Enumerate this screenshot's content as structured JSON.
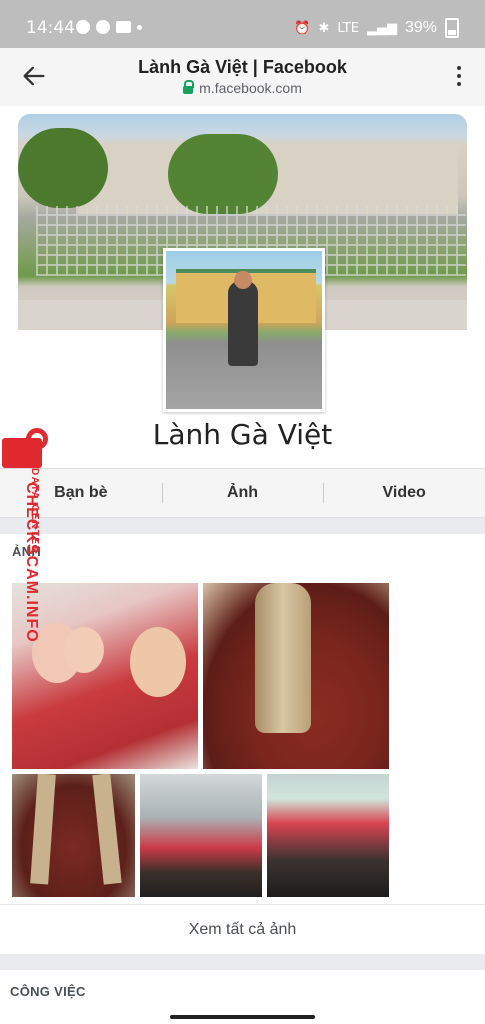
{
  "status_bar": {
    "time": "14:44",
    "battery": "39%",
    "network": "LTE"
  },
  "browser": {
    "title": "Lành Gà Việt | Facebook",
    "url": "m.facebook.com"
  },
  "profile": {
    "name": "Lành Gà Việt"
  },
  "tabs": [
    "Bạn bè",
    "Ảnh",
    "Video"
  ],
  "photos_section": {
    "label": "ẢNH",
    "see_all": "Xem tất cả ảnh"
  },
  "job_section": {
    "label": "CÔNG VIỆC"
  },
  "watermark": {
    "text": "CHECKSCAM.INFO",
    "sub": "DATA CENTER"
  }
}
